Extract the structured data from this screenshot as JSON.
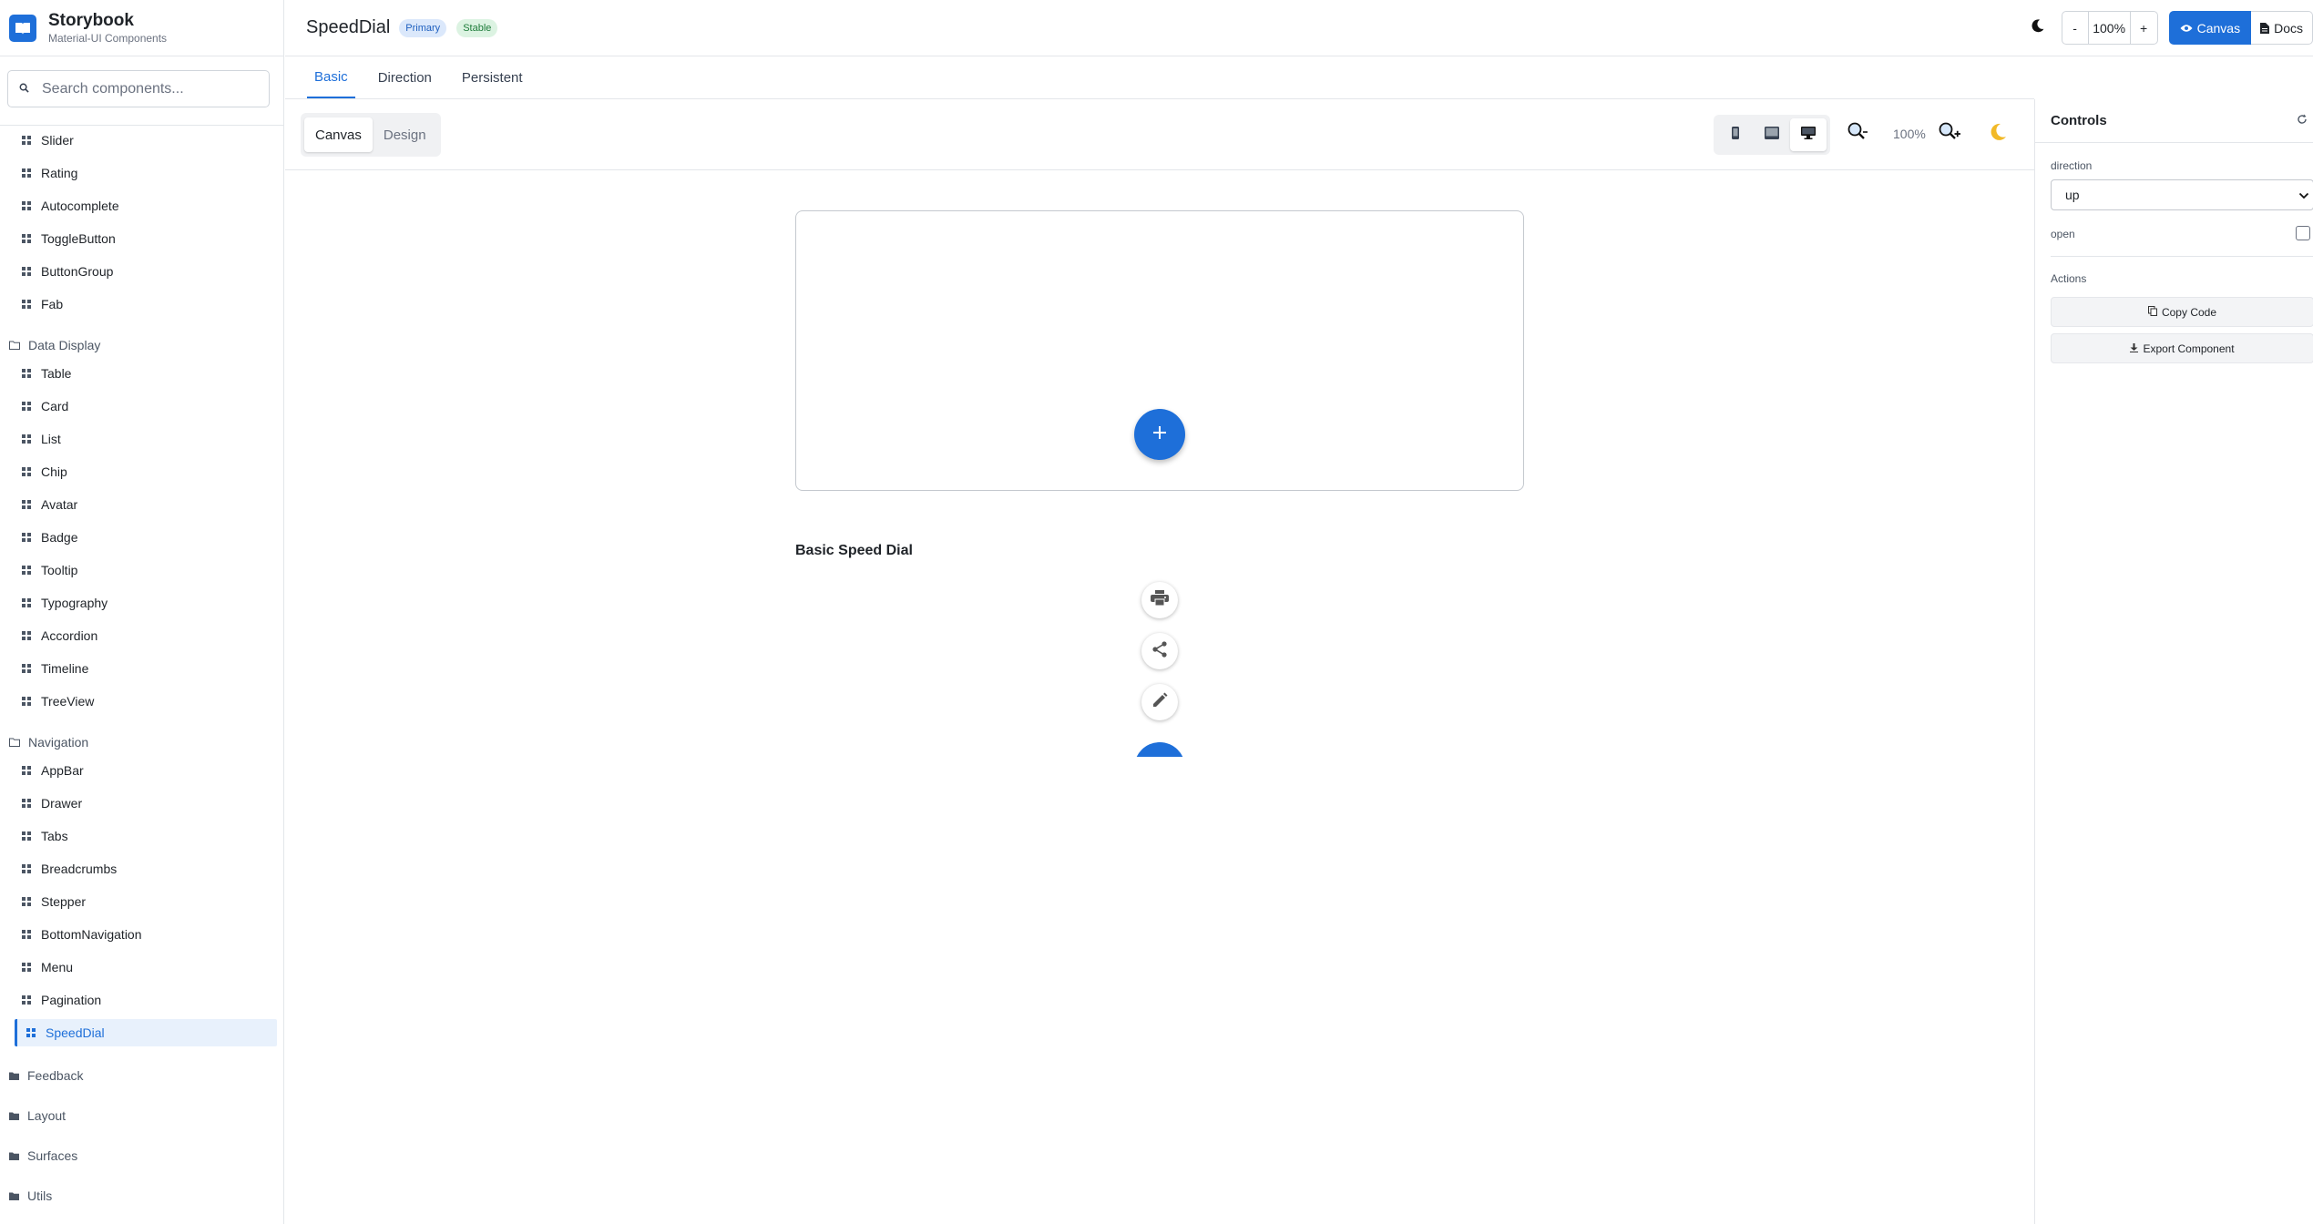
{
  "brand": {
    "title": "Storybook",
    "subtitle": "Material-UI Components"
  },
  "search": {
    "placeholder": "Search components..."
  },
  "sidebar": {
    "inputs_items": [
      "Slider",
      "Rating",
      "Autocomplete",
      "ToggleButton",
      "ButtonGroup",
      "Fab"
    ],
    "data_display": {
      "label": "Data Display",
      "items": [
        "Table",
        "Card",
        "List",
        "Chip",
        "Avatar",
        "Badge",
        "Tooltip",
        "Typography",
        "Accordion",
        "Timeline",
        "TreeView"
      ]
    },
    "navigation": {
      "label": "Navigation",
      "items": [
        "AppBar",
        "Drawer",
        "Tabs",
        "Breadcrumbs",
        "Stepper",
        "BottomNavigation",
        "Menu",
        "Pagination",
        "SpeedDial"
      ],
      "active": "SpeedDial"
    },
    "collapsed_groups": [
      "Feedback",
      "Layout",
      "Surfaces",
      "Utils"
    ]
  },
  "header": {
    "title": "SpeedDial",
    "badges": [
      "Primary",
      "Stable"
    ],
    "zoom": {
      "minus": "-",
      "value": "100%",
      "plus": "+"
    },
    "canvas_label": "Canvas",
    "docs_label": "Docs"
  },
  "story_tabs": [
    "Basic",
    "Direction",
    "Persistent"
  ],
  "toolbar": {
    "segments": [
      "Canvas",
      "Design"
    ],
    "zoom_value": "100%",
    "devices": [
      "mobile-icon",
      "tablet-icon",
      "desktop-icon"
    ]
  },
  "canvas": {
    "story_title": "Basic Speed Dial",
    "actions": [
      "print-icon",
      "share-icon",
      "edit-icon"
    ]
  },
  "controls": {
    "title": "Controls",
    "direction_label": "direction",
    "direction_value": "up",
    "open_label": "open",
    "actions_label": "Actions",
    "copy_code": "Copy Code",
    "export_component": "Export Component"
  },
  "colors": {
    "accent": "#1e6fd9",
    "active_bg": "#e8f1fc"
  }
}
